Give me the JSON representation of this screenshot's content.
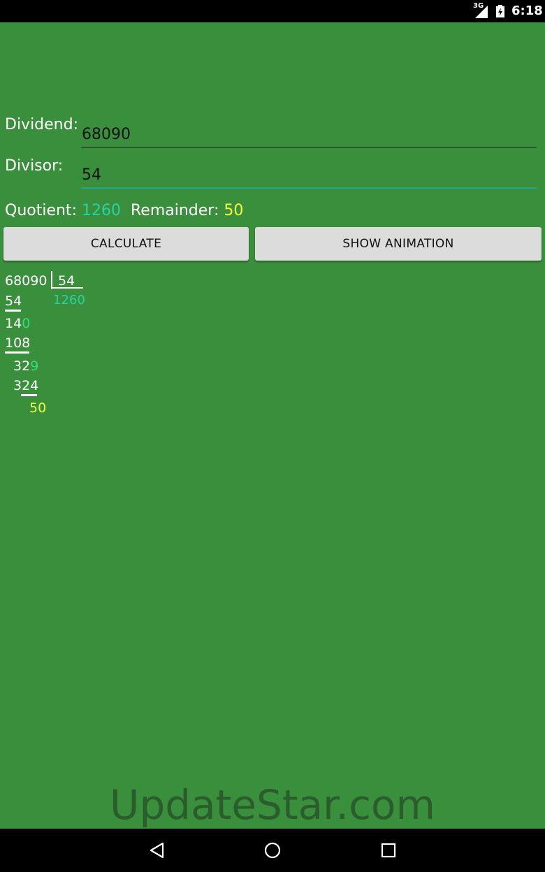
{
  "status": {
    "network": "3G",
    "time": "6:18"
  },
  "form": {
    "dividend_label": "Dividend:",
    "dividend_value": "68090",
    "divisor_label": "Divisor:",
    "divisor_value": "54"
  },
  "result": {
    "quotient_label": "Quotient:",
    "quotient_value": "1260",
    "remainder_label": "Remainder:",
    "remainder_value": "50"
  },
  "buttons": {
    "calculate": "CALCULATE",
    "show_animation": "SHOW ANIMATION"
  },
  "long_division": {
    "dividend": "68090",
    "divisor": "54",
    "quotient": "1260",
    "steps": [
      {
        "text": "54"
      },
      {
        "text": "14",
        "brought_down": "0"
      },
      {
        "text": "108"
      },
      {
        "text": "32",
        "brought_down": "9"
      },
      {
        "text": "324"
      }
    ],
    "remainder": "50"
  },
  "watermark": "UpdateStar.com",
  "colors": {
    "background": "#3a8f3d",
    "quotient": "#27d3a5",
    "remainder": "#f2ff3e",
    "brought_down": "#2ee07a"
  }
}
